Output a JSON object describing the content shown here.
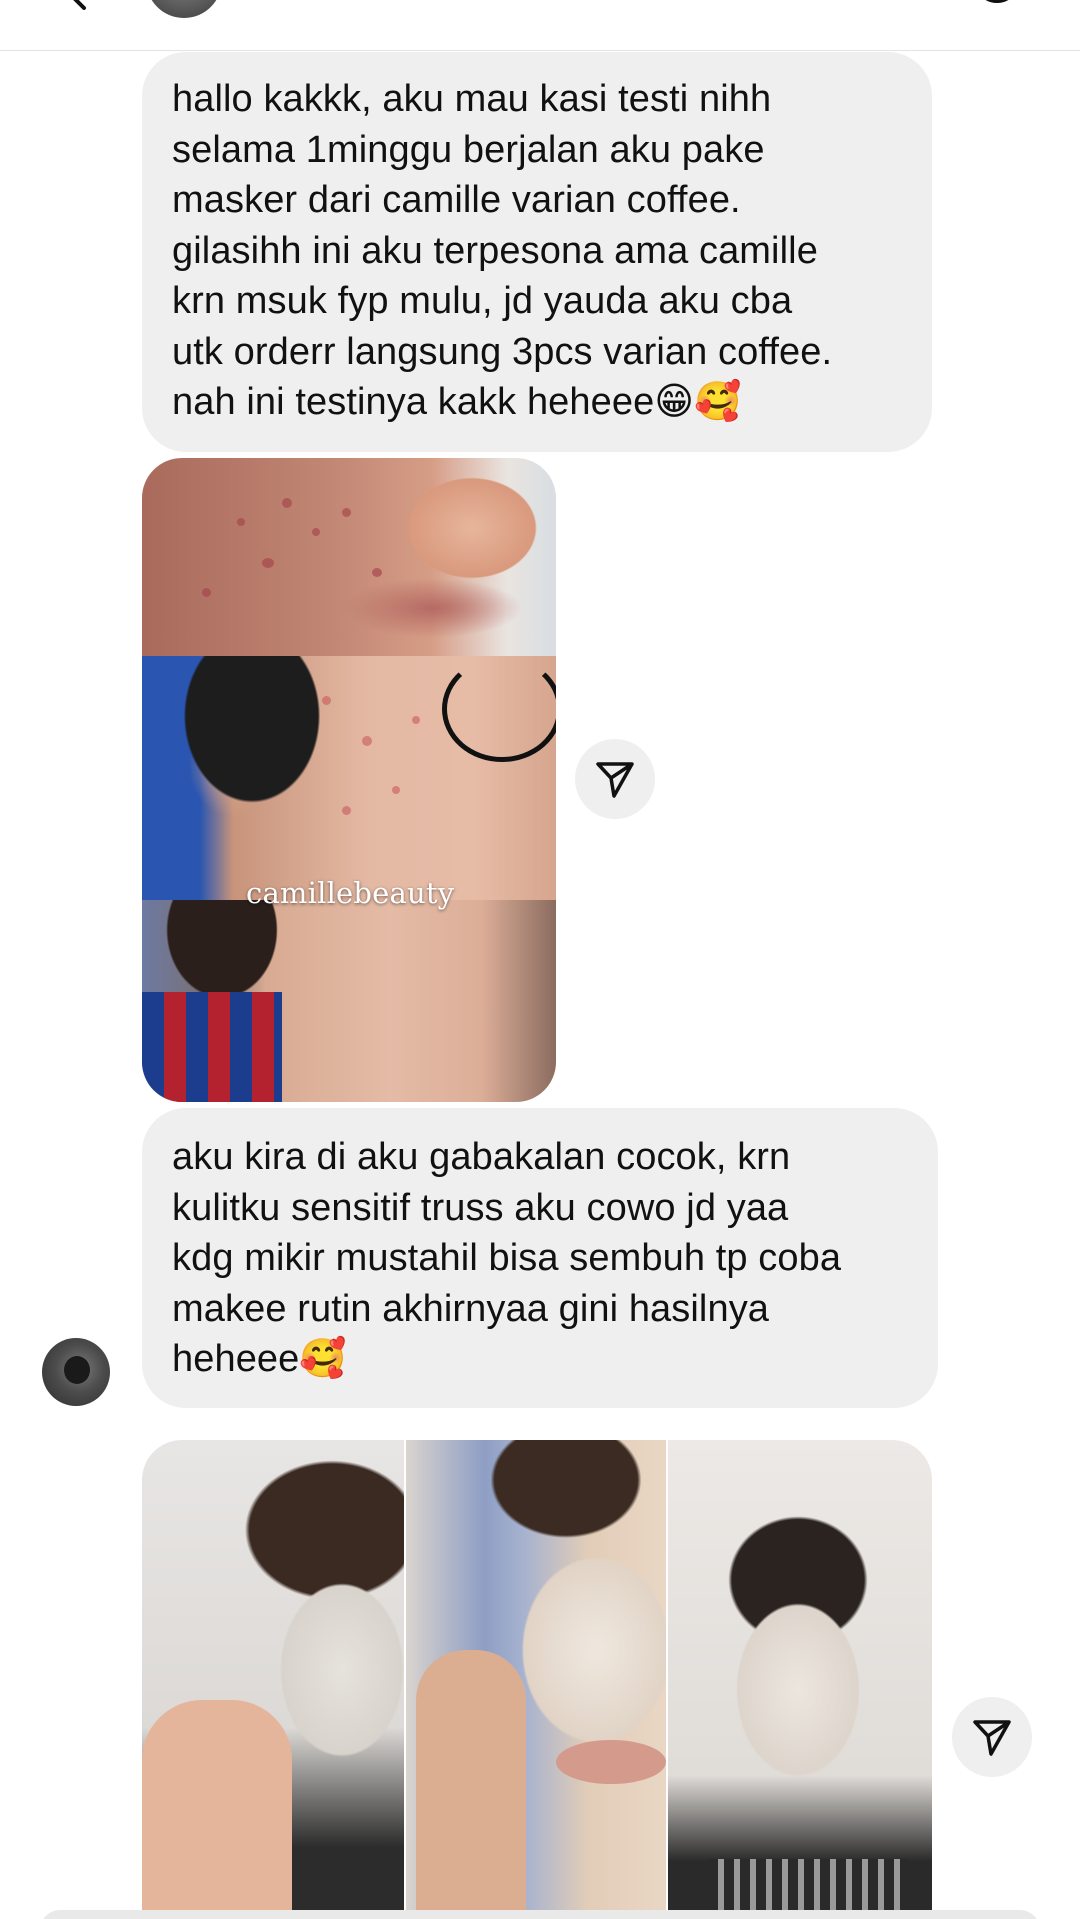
{
  "header": {
    "back_icon": "chevron-left-icon",
    "video_icon": "video-camera-icon",
    "call_icon": "phone-icon",
    "info_icon": "info-icon"
  },
  "messages": [
    {
      "type": "text",
      "text": "hallo kakkk, aku mau kasi testi nihh\nselama 1minggu berjalan aku pake\nmasker dari camille varian coffee.\ngilasihh ini aku terpesona ama camille\nkrn msuk fyp mulu, jd yauda aku cba\nutk orderr langsung 3pcs varian coffee.\nnah ini testinya kakk heheee😁🥰"
    },
    {
      "type": "image",
      "watermark": "camillebeauty"
    },
    {
      "type": "text",
      "text": "aku kira di aku gabakalan cocok, krn\nkulitku sensitif truss aku cowo jd yaa\nkdg mikir mustahil bisa sembuh tp coba\nmakee rutin akhirnyaa gini hasilnya\nheheee🥰"
    },
    {
      "type": "image"
    }
  ],
  "icons": {
    "share": "paper-plane-icon"
  },
  "colors": {
    "bubble_bg": "#efefef",
    "text": "#111111",
    "page_bg": "#ffffff"
  }
}
